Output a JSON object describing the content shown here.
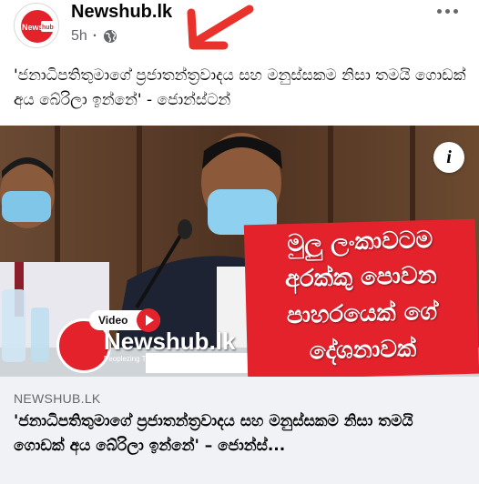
{
  "post": {
    "page_name": "Newshub.lk",
    "avatar_text": "Newshub.lk",
    "time": "5h",
    "separator": "·",
    "privacy_icon": "globe-icon",
    "more_icon": "more-options-icon",
    "caption": "'ජනාධිපතිතුමාගේ ප්‍රජාතන්ත්‍රවාදය සහ මනුස්සකම නිසා තමයි ගොඩක් අය බේරිලා ඉන්නේ' - ජොන්ස්ටන්"
  },
  "image": {
    "info_icon": "info-icon",
    "info_label": "i",
    "headline": {
      "line1": "මුලු ලංකාවටම",
      "line2": "අරක්කු පොවන",
      "line3": "පාහරයෙක් ගේ",
      "line4": "දේශනාවක්"
    },
    "video_label": "Video",
    "watermark_brand": "Newshub.lk",
    "watermark_tagline": "Peoplezing The News",
    "colors": {
      "brand_red": "#e3222c",
      "annotation_arrow": "#e8322b"
    }
  },
  "link_preview": {
    "domain": "NEWSHUB.LK",
    "title": "'ජනාධිපතිතුමාගේ ප්‍රජාතන්ත්‍රවාදය සහ මනුස්සකම නිසා තමයි ගොඩක් අය බේරිලා ඉන්නේ' – ජොන්ස්..."
  }
}
